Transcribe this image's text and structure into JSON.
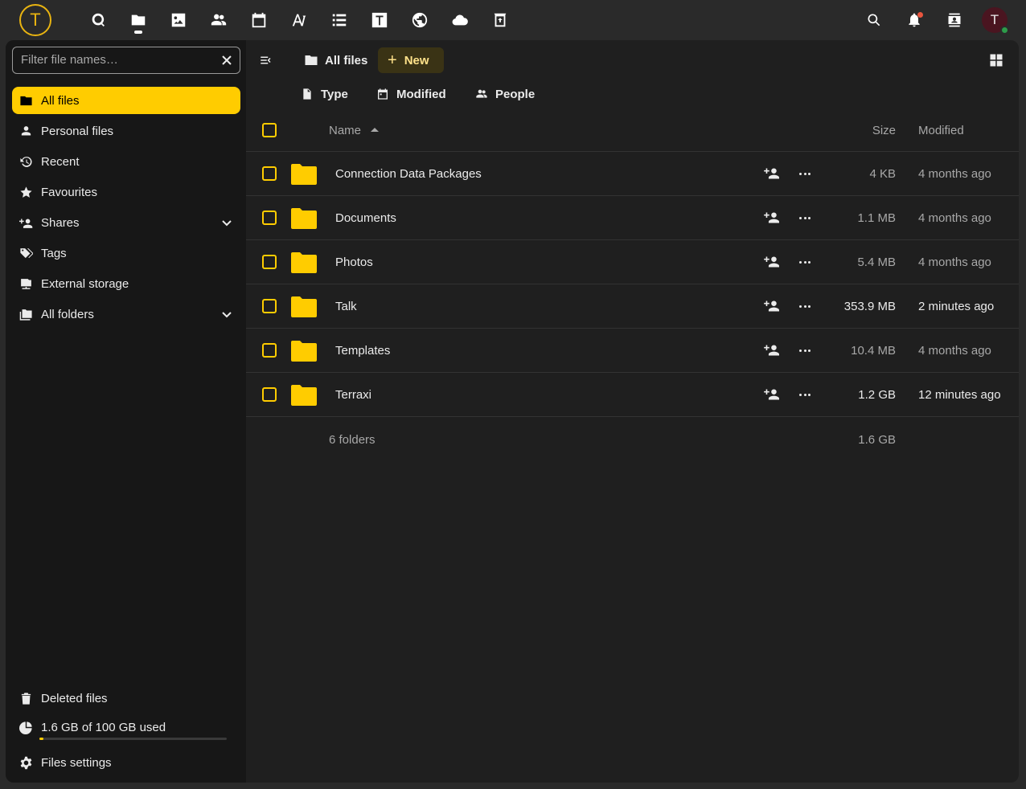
{
  "logo": {
    "letter": "T"
  },
  "topbar": {
    "apps": [
      {
        "name": "dashboard-icon"
      },
      {
        "name": "files-icon",
        "active": true
      },
      {
        "name": "photos-icon"
      },
      {
        "name": "contacts-icon"
      },
      {
        "name": "calendar-icon"
      },
      {
        "name": "notes-icon"
      },
      {
        "name": "tasks-icon"
      },
      {
        "name": "text-icon"
      },
      {
        "name": "globe-icon"
      },
      {
        "name": "cloud-icon"
      },
      {
        "name": "recycle-icon"
      }
    ],
    "avatar_letter": "T"
  },
  "sidebar": {
    "filter_placeholder": "Filter file names…",
    "items": [
      {
        "label": "All files",
        "icon": "folder-icon",
        "active": true
      },
      {
        "label": "Personal files",
        "icon": "user-icon"
      },
      {
        "label": "Recent",
        "icon": "history-icon"
      },
      {
        "label": "Favourites",
        "icon": "star-icon"
      },
      {
        "label": "Shares",
        "icon": "share-icon",
        "expandable": true
      },
      {
        "label": "Tags",
        "icon": "tag-icon"
      },
      {
        "label": "External storage",
        "icon": "external-storage-icon"
      },
      {
        "label": "All folders",
        "icon": "folders-icon",
        "expandable": true
      }
    ],
    "deleted_label": "Deleted files",
    "quota_label": "1.6 GB of 100 GB used",
    "quota_fraction": 0.016,
    "settings_label": "Files settings"
  },
  "toolbar": {
    "breadcrumb": "All files",
    "new_label": "New",
    "filters": [
      "Type",
      "Modified",
      "People"
    ]
  },
  "table": {
    "headers": {
      "name": "Name",
      "size": "Size",
      "modified": "Modified"
    },
    "rows": [
      {
        "name": "Connection Data Packages",
        "size": "4 KB",
        "modified": "4 months ago",
        "recent": false
      },
      {
        "name": "Documents",
        "size": "1.1 MB",
        "modified": "4 months ago",
        "recent": false
      },
      {
        "name": "Photos",
        "size": "5.4 MB",
        "modified": "4 months ago",
        "recent": false
      },
      {
        "name": "Talk",
        "size": "353.9 MB",
        "modified": "2 minutes ago",
        "recent": true
      },
      {
        "name": "Templates",
        "size": "10.4 MB",
        "modified": "4 months ago",
        "recent": false
      },
      {
        "name": "Terraxi",
        "size": "1.2 GB",
        "modified": "12 minutes ago",
        "recent": true
      }
    ],
    "summary": {
      "count": "6 folders",
      "size": "1.6 GB"
    }
  },
  "colors": {
    "accent": "#ffcc00",
    "background": "#1f1f1f",
    "sidebar": "#171717"
  }
}
